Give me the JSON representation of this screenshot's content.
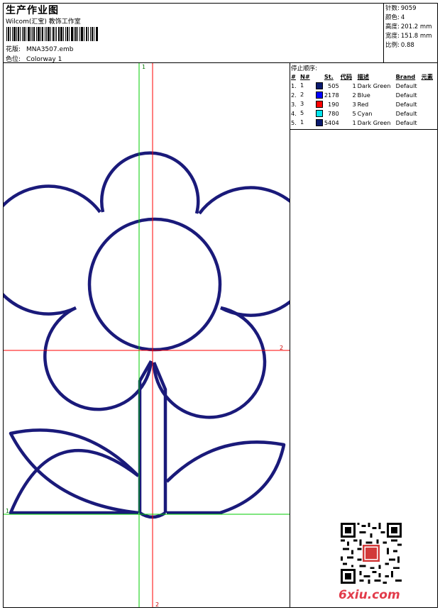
{
  "header": {
    "title": "生产作业图",
    "subtitle": "Wilcom(汇宝) 教饰工作室",
    "pattern_label": "花版:",
    "pattern_value": "MNA3507.emb",
    "colorway_label": "色位:",
    "colorway_value": "Colorway 1"
  },
  "stats": [
    {
      "label": "针数:",
      "value": "9059"
    },
    {
      "label": "颜色:",
      "value": "4"
    },
    {
      "label": "高度:",
      "value": "201.2 mm"
    },
    {
      "label": "宽度:",
      "value": "151.8 mm"
    },
    {
      "label": "比例:",
      "value": "0.88"
    }
  ],
  "stop_sequence": {
    "title": "停止顺序:",
    "columns": [
      "#",
      "N#",
      "St.",
      "代码",
      "描述",
      "Brand",
      "元素"
    ],
    "rows": [
      {
        "idx": "1.",
        "n": "1",
        "st": "505",
        "code": "1",
        "desc": "Dark Green",
        "brand": "Default",
        "color": "#0a1a6e"
      },
      {
        "idx": "2.",
        "n": "2",
        "st": "2178",
        "code": "2",
        "desc": "Blue",
        "brand": "Default",
        "color": "#0000ff"
      },
      {
        "idx": "3.",
        "n": "3",
        "st": "190",
        "code": "3",
        "desc": "Red",
        "brand": "Default",
        "color": "#ff0000"
      },
      {
        "idx": "4.",
        "n": "5",
        "st": "780",
        "code": "5",
        "desc": "Cyan",
        "brand": "Default",
        "color": "#00e5ee"
      },
      {
        "idx": "5.",
        "n": "1",
        "st": "5404",
        "code": "1",
        "desc": "Dark Green",
        "brand": "Default",
        "color": "#0a1a6e"
      }
    ]
  },
  "guides": {
    "v_green_top": "1",
    "h_red_right": "2",
    "h_green_left": "1",
    "v_red_bottom": "2"
  },
  "colors": {
    "stitch": "#1a1a7a",
    "guide_green": "#00cc00",
    "guide_red": "#ff0000"
  },
  "watermark": "6xiu.com"
}
